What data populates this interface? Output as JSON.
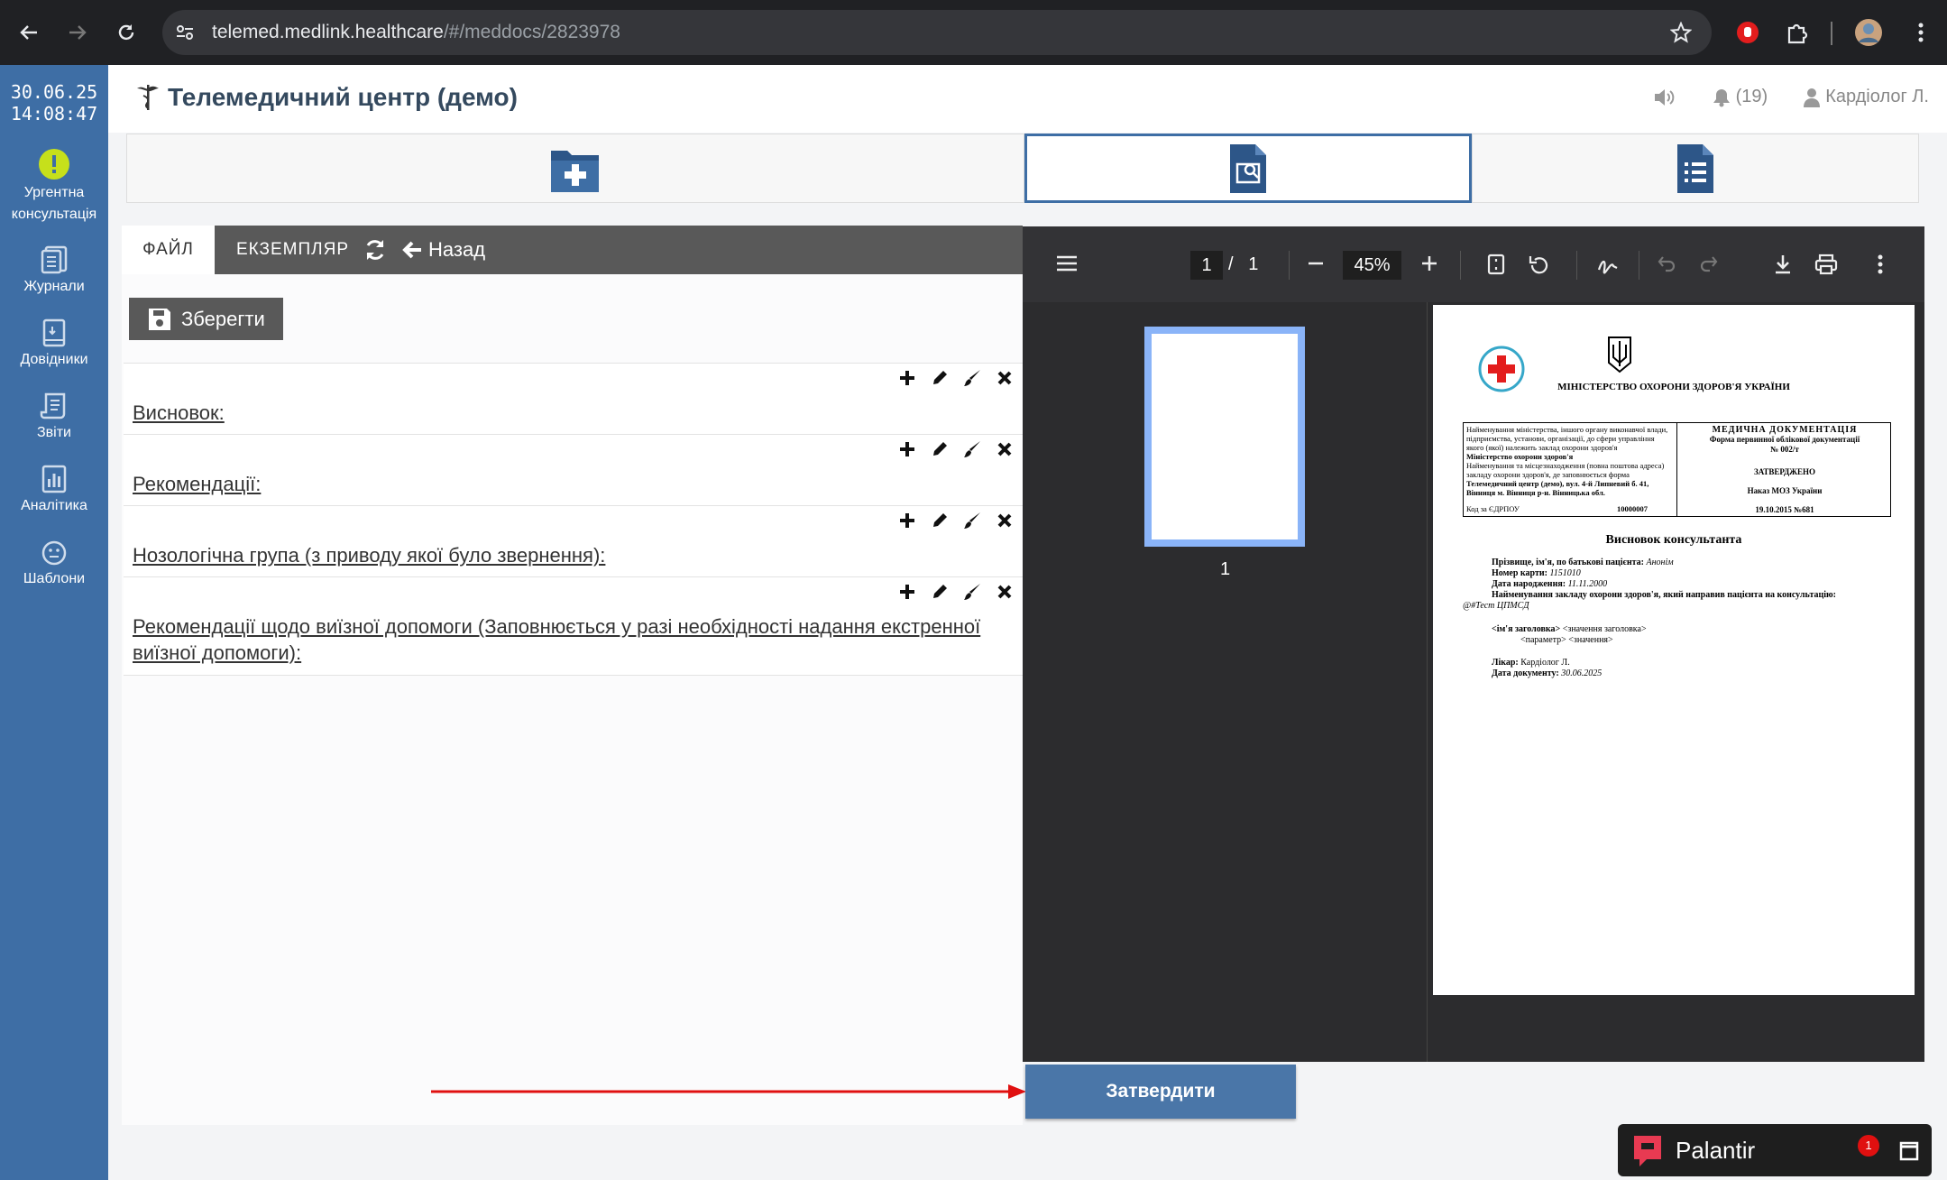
{
  "browser": {
    "url_host": "telemed.medlink.healthcare",
    "url_path": "/#/meddocs/2823978"
  },
  "sidebar": {
    "date": "30.06.25",
    "time": "14:08:47",
    "items": [
      {
        "label": "Ургентна консультація",
        "icon": "exclamation-icon"
      },
      {
        "label": "Журнали",
        "icon": "journal-icon"
      },
      {
        "label": "Довідники",
        "icon": "directory-icon"
      },
      {
        "label": "Звіти",
        "icon": "report-icon"
      },
      {
        "label": "Аналітика",
        "icon": "analytics-icon"
      },
      {
        "label": "Шаблони",
        "icon": "template-icon"
      }
    ]
  },
  "header": {
    "title": "Телемедичний центр (демо)",
    "notifications": "(19)",
    "user": "Кардіолог Л."
  },
  "editor": {
    "tabs": {
      "file": "ФАЙЛ",
      "copy": "ЕКЗЕМПЛЯР",
      "back": "Назад"
    },
    "save_label": "Зберегти",
    "sections": [
      "Висновок:",
      "Рекомендації:",
      "Нозологічна група (з приводу якої було звернення):",
      "Рекомендації щодо виїзної допомоги (Заповнюється у разі необхідності надання екстренної виїзної допомоги):"
    ]
  },
  "pdf": {
    "page": "1",
    "page_sep": "/",
    "page_total": "1",
    "zoom": "45%",
    "thumb_label": "1",
    "doc": {
      "ministry": "МІНІСТЕРСТВО ОХОРОНИ ЗДОРОВ'Я УКРАЇНИ",
      "left_block": "Найменування міністерства, іншого органу виконавчої влади, підприємства, установи, організації, до сфери управління якого (якої) належить заклад охорони здоров'я",
      "left_bold1": "Міністерство охорони здоров'я",
      "left_block2": "Найменування та місцезнаходження (повна поштова адреса) закладу охорони здоров'я, де заповнюється форма",
      "left_bold2": "Телемедичний центр (демо), вул. 4-й Липневий б. 41, Вінниця м. Вінниця р-н. Вінницька обл.",
      "edrpou_label": "Код за ЄДРПОУ",
      "edrpou": "10000007",
      "right_title": "МЕДИЧНА ДОКУМЕНТАЦІЯ",
      "right_sub": "Форма первинної облікової документації № 002/т",
      "approved": "ЗАТВЕРДЖЕНО",
      "order": "Наказ МОЗ України",
      "order_date": "19.10.2015 №681",
      "doc_title": "Висновок консультанта",
      "patient_label": "Прізвище, ім'я, по батькові пацієнта:",
      "patient": "Анонім",
      "card_label": "Номер карти:",
      "card": "1151010",
      "dob_label": "Дата народження:",
      "dob": "11.11.2000",
      "referrer_label": "Найменування закладу охорони здоров'я, який направив пацієнта на консультацію:",
      "referrer": "@#Тест ЦПМСД",
      "header_name": "<ім'я заголовка>",
      "header_value": "<значення заголовка>",
      "param": "<параметр> <значення>",
      "doctor_label": "Лікар:",
      "doctor": "Кардіолог Л.",
      "docdate_label": "Дата документу:",
      "docdate": "30.06.2025"
    }
  },
  "approve_label": "Затвердити",
  "palantir": {
    "label": "Палантир",
    "display": "Palantir",
    "badge": "1"
  },
  "colors": {
    "sidebar": "#3e6ea5",
    "accent": "#4a76a8",
    "arrow": "#e01010"
  }
}
